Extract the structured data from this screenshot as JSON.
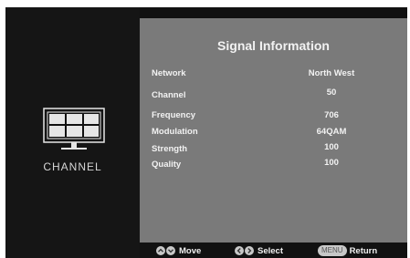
{
  "left": {
    "icon": "tv-channel-icon",
    "label": "CHANNEL"
  },
  "panel": {
    "title": "Signal Information",
    "rows": [
      {
        "label": "Network",
        "value": "North West"
      },
      {
        "label": "Channel",
        "value": "50"
      },
      {
        "label": "Frequency",
        "value": "706"
      },
      {
        "label": "Modulation",
        "value": "64QAM"
      },
      {
        "label": "Strength",
        "value": "100"
      },
      {
        "label": "Quality",
        "value": "100"
      }
    ]
  },
  "footer": {
    "move": {
      "icon": "up-down-buttons-icon",
      "label": "Move"
    },
    "select": {
      "icon": "left-right-buttons-icon",
      "label": "Select"
    },
    "return": {
      "key": "MENU",
      "label": "Return"
    }
  },
  "colors": {
    "screen_bg": "#111111",
    "panel_bg": "#7a7a7a",
    "text": "#f2f2f2"
  }
}
